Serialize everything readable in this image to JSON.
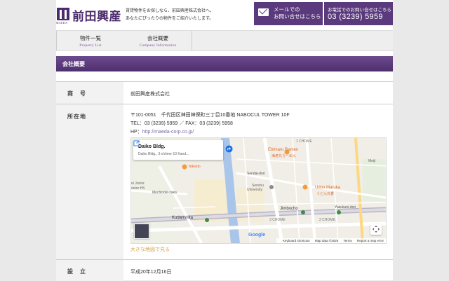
{
  "header": {
    "logo_text": "前田興産",
    "logo_sub": "MAEDA",
    "tagline_line1": "賃貸物件をお探しなら、前田興産株式会社へ。",
    "tagline_line2": "あなたにぴったりの物件をご紹介いたします。",
    "mail_line1": "メールでの",
    "mail_line2": "お問い合せはこちら",
    "tel_label": "お電話でのお問い合せはこちら",
    "tel_number": "03 (3239) 5959"
  },
  "nav": [
    {
      "jp": "物件一覧",
      "en": "Property List"
    },
    {
      "jp": "会社概要",
      "en": "Company Information"
    }
  ],
  "section_title": "会社概要",
  "company": {
    "name_label": "商　号",
    "name_value": "前田興産株式会社",
    "address_label": "所在地",
    "address_line": "〒101-0051　千代田区神田神保町三丁目10番地 NABOCUL TOWER 10F",
    "tel_fax_line": "TEL：03 (3239) 5959 ／ FAX：03 (3239) 5958",
    "hp_label": "HP：",
    "hp_url": "http://maeda-corp.co.jp/",
    "map_link": "大きな地図で見る",
    "established_label": "設　立",
    "established_value": "平成20年12月16日"
  },
  "map": {
    "card_title": "Daiko Bldg.",
    "card_address": "Daiko Bldg., 3-chōme-10 Kand...",
    "footer_items": [
      "Keyboard shortcuts",
      "Map data ©2026",
      "Terms",
      "Report a map error"
    ],
    "google": "Google",
    "labels": {
      "ebimaru": "Ebimaru Ramen",
      "ebimaru_jp": "海老丸らーめん",
      "sendai": "Sendai-dori",
      "senshu": "Senshu",
      "senshu2": "University",
      "nikeido": "Nikeido",
      "junior": "ei Junior",
      "junior2": "enior HS",
      "mochinoki": "Mochinoki-zaka",
      "udon": "Udon Maruka",
      "udon_jp": "うどん丸香",
      "meiji": "Meiji",
      "jimbocho": "Jimbocho",
      "kudanshita": "Kudanshita",
      "chome1": "1 CHOME",
      "chome3": "3 CHOME",
      "chome2": "2 CHOME",
      "yasukuni": "Yasukuni-dori"
    }
  },
  "colors": {
    "brand": "#5a3a7c",
    "accent_link": "#d4a64a"
  }
}
